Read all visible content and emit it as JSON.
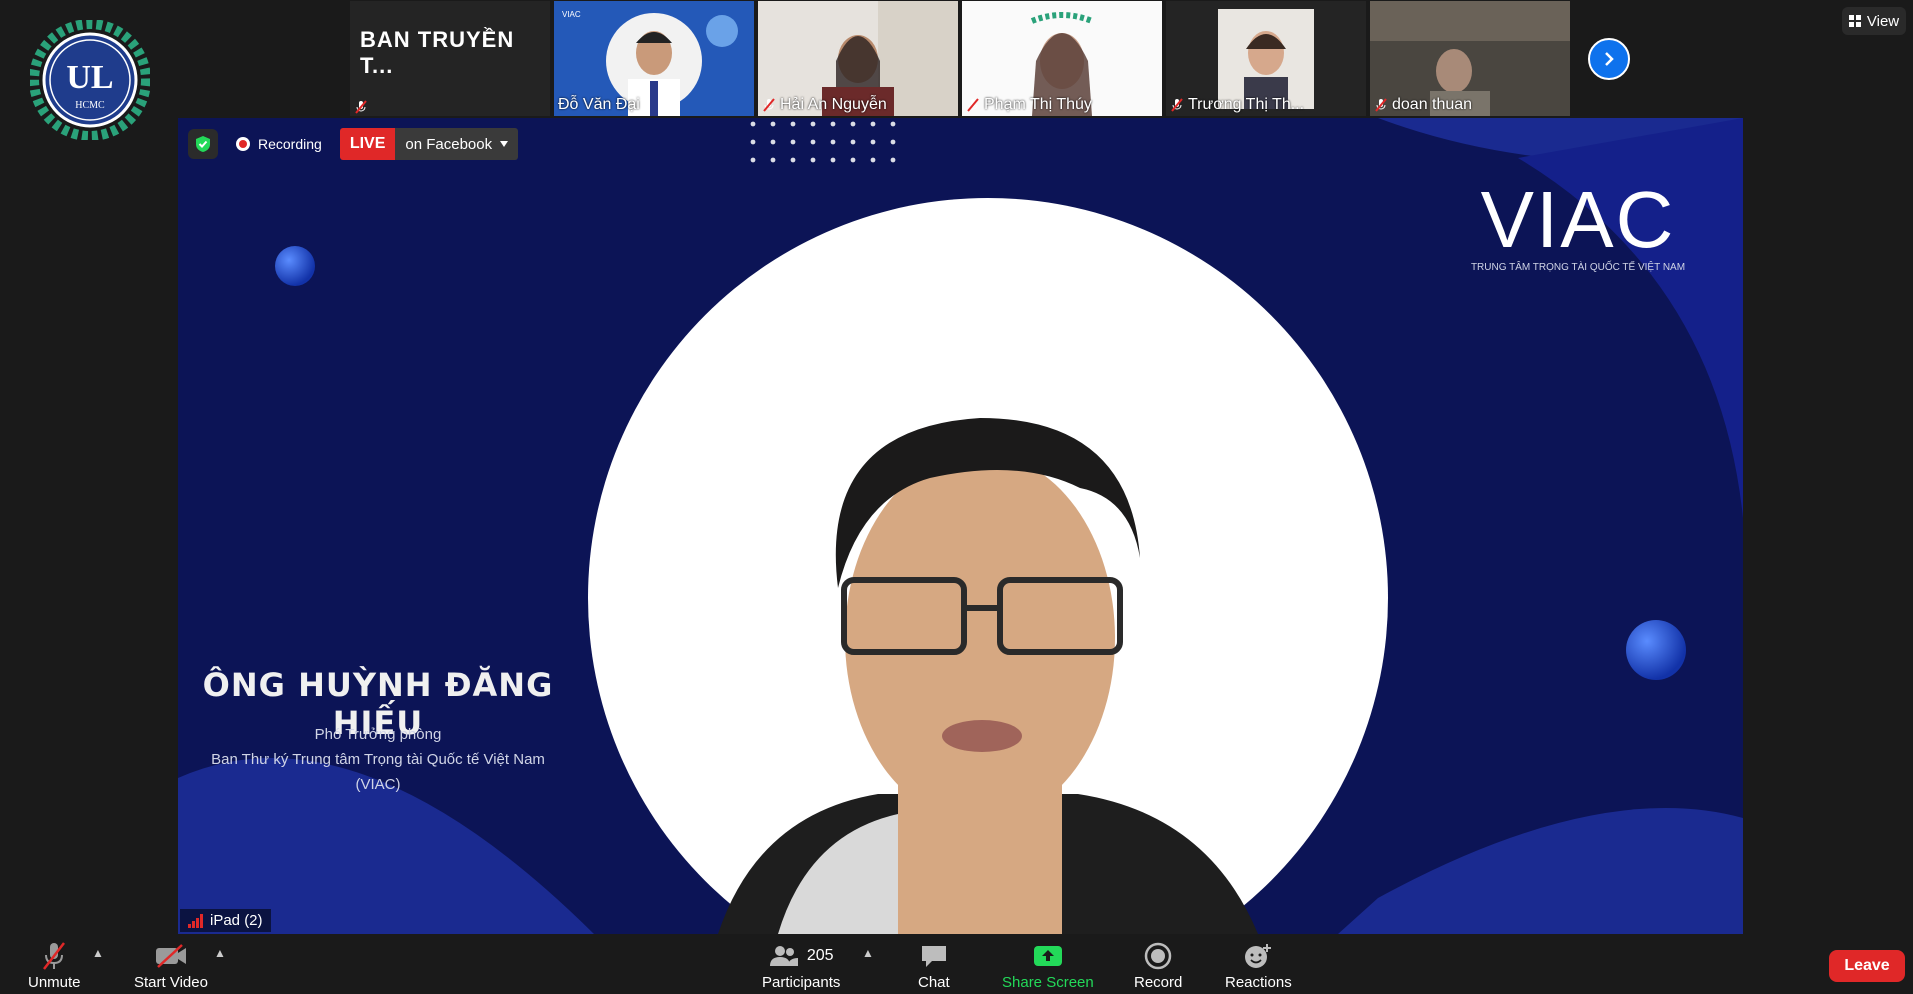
{
  "logo": {
    "text": "HCMC"
  },
  "gallery": {
    "title_tile": "BAN TRUYỀN T...",
    "tiles": [
      {
        "name": "Đỗ Văn Đại"
      },
      {
        "name": "Hải An Nguyễn"
      },
      {
        "name": "Phạm Thị Thúy"
      },
      {
        "name": "Trương Thị Th..."
      },
      {
        "name": "doan thuan"
      }
    ],
    "view_label": "View"
  },
  "stage": {
    "recording_label": "Recording",
    "live_label": "LIVE",
    "live_target": "on Facebook",
    "brand": "VIAC",
    "brand_sub": "TRUNG TÂM TRỌNG TÀI QUỐC TẾ VIỆT NAM",
    "speaker_name": "ÔNG HUỲNH ĐĂNG HIẾU",
    "speaker_role_1": "Phó Trưởng phòng",
    "speaker_role_2": "Ban Thư ký Trung tâm Trọng tài Quốc tế Việt Nam",
    "speaker_role_3": "(VIAC)",
    "active_device": "iPad (2)"
  },
  "toolbar": {
    "unmute": "Unmute",
    "start_video": "Start Video",
    "participants": "Participants",
    "participants_count": "205",
    "chat": "Chat",
    "share_screen": "Share Screen",
    "record": "Record",
    "reactions": "Reactions",
    "leave": "Leave"
  },
  "colors": {
    "accent": "#0e72ed",
    "live": "#e02828",
    "share": "#23d959",
    "stage_bg": "#0c1456"
  }
}
